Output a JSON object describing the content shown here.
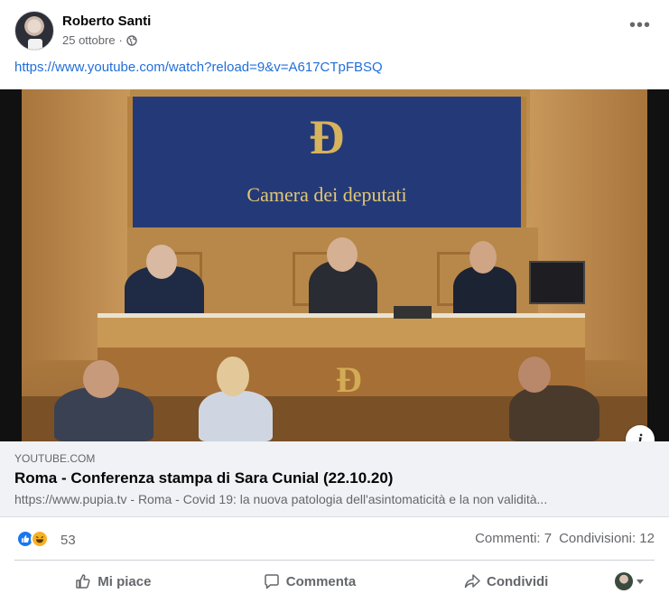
{
  "post": {
    "author": "Roberto Santi",
    "date": "25 ottobre",
    "separator": "·",
    "link_text": "https://www.youtube.com/watch?reload=9&v=A617CTpFBSQ"
  },
  "video": {
    "backdrop_text": "Camera dei deputati"
  },
  "card": {
    "domain": "YOUTUBE.COM",
    "title": "Roma - Conferenza stampa di Sara Cunial (22.10.20)",
    "description": "https://www.pupia.tv - Roma - Covid 19: la nuova patologia dell'asintomaticità e la non validità..."
  },
  "reactions": {
    "count": "53",
    "comments": "Commenti: 7",
    "shares": "Condivisioni: 12"
  },
  "actions": {
    "like": "Mi piace",
    "comment": "Commenta",
    "share": "Condividi"
  },
  "icons": {
    "reaction_like_color": "#1877f2",
    "reaction_haha_color": "#f7b125",
    "link_color": "#216fdb"
  }
}
